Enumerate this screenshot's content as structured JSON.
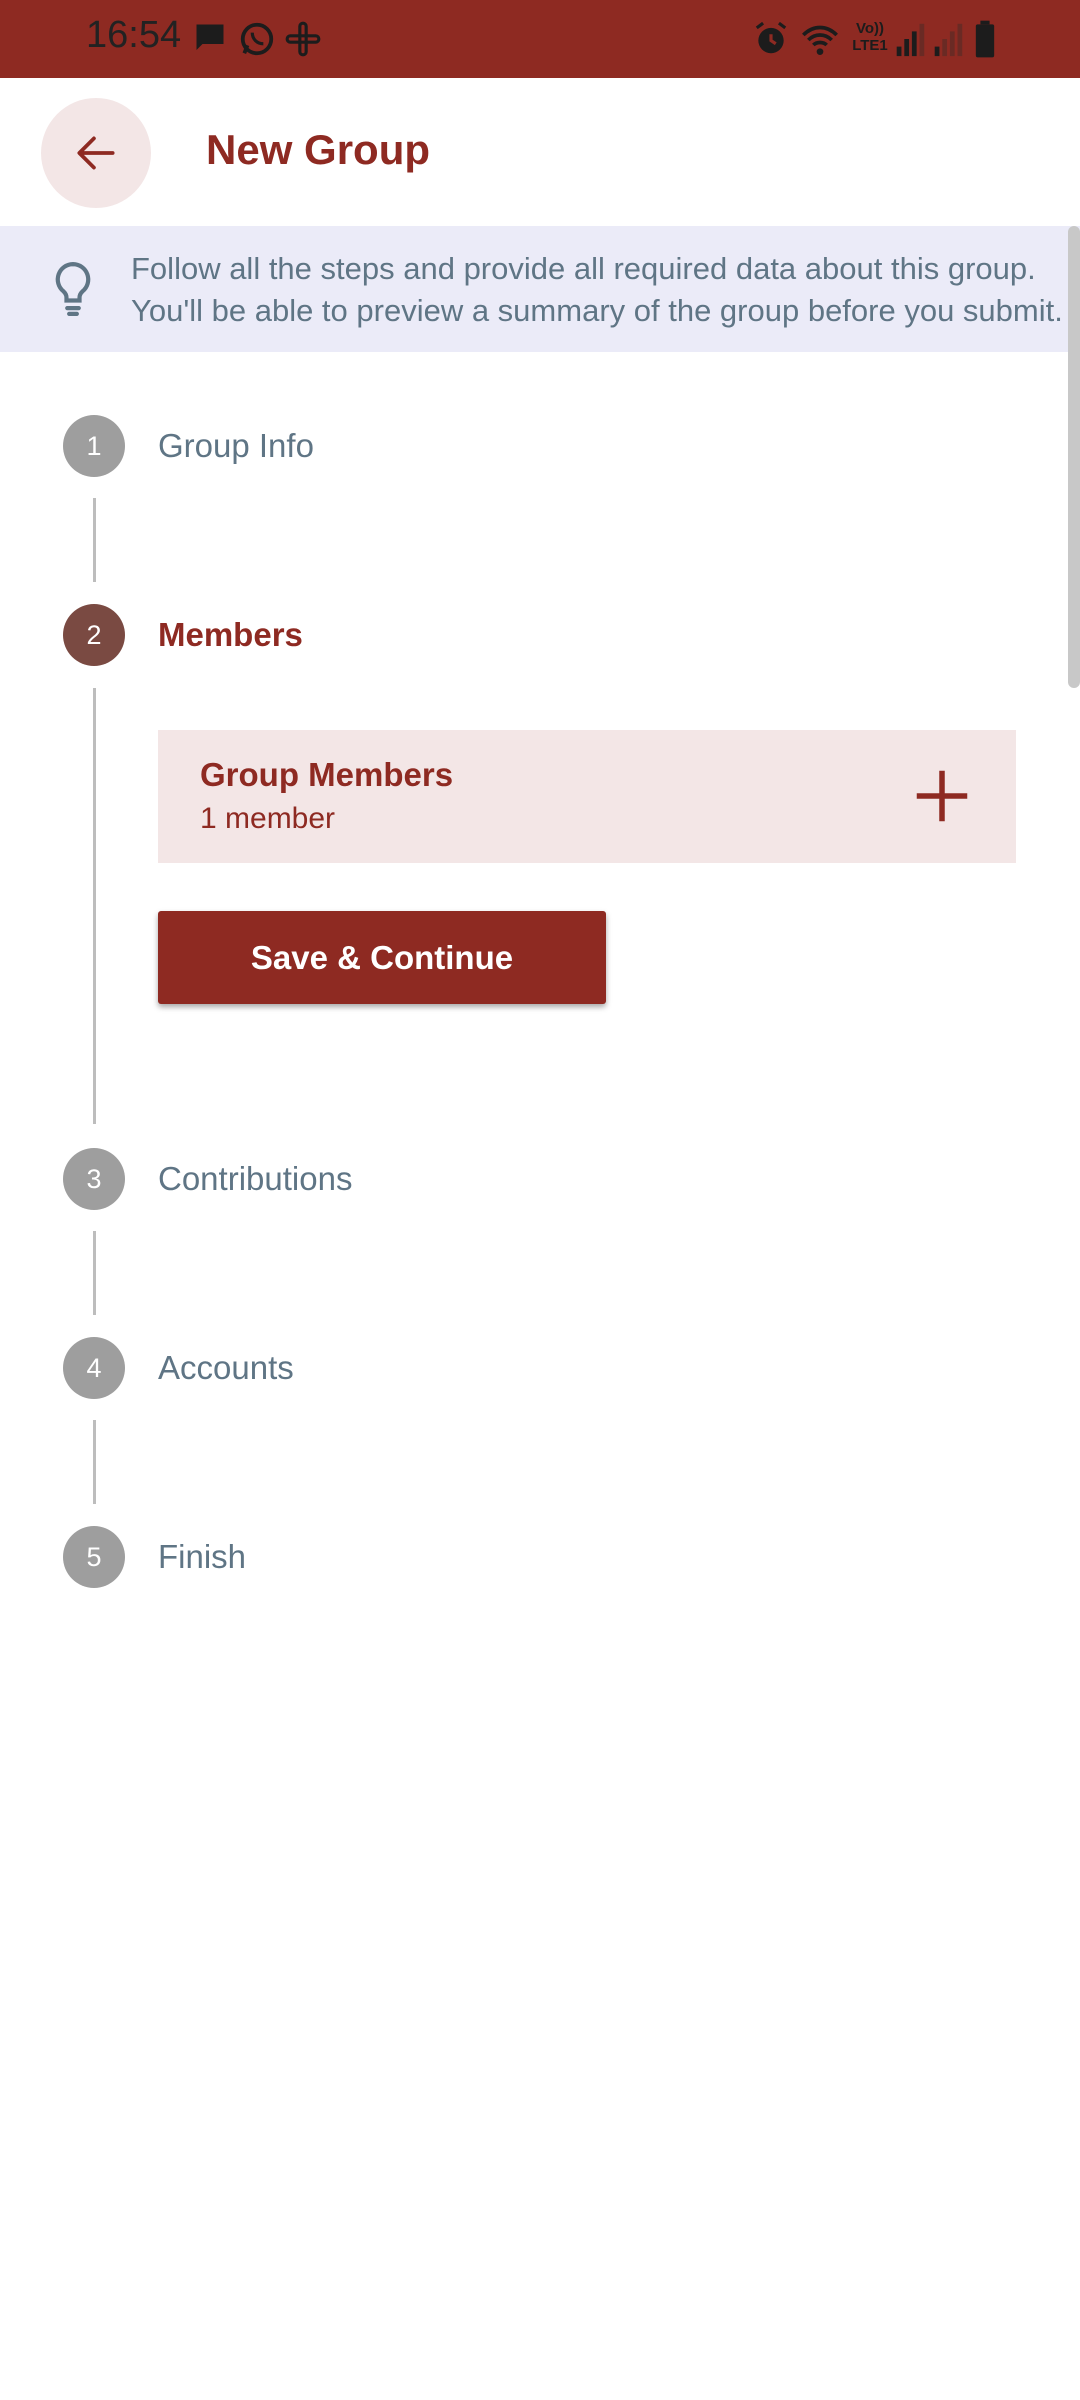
{
  "status_bar": {
    "time": "16:54",
    "left_icons": [
      "message-icon",
      "whatsapp-icon",
      "slack-icon"
    ],
    "right_icons": [
      "alarm-icon",
      "wifi-icon",
      "volte-icon",
      "signal-icon",
      "signal-weak-icon",
      "battery-icon"
    ],
    "volte_label_top": "Vo))",
    "volte_label_bottom": "LTE1"
  },
  "header": {
    "title": "New Group",
    "back_icon": "arrow-left-icon"
  },
  "tip": {
    "icon": "lightbulb-icon",
    "line1": "Follow all the steps and provide all required data about this group.",
    "line2": "You'll be able to preview a summary of the group before you submit."
  },
  "steps": [
    {
      "number": "1",
      "label": "Group Info",
      "active": false
    },
    {
      "number": "2",
      "label": "Members",
      "active": true
    },
    {
      "number": "3",
      "label": "Contributions",
      "active": false
    },
    {
      "number": "4",
      "label": "Accounts",
      "active": false
    },
    {
      "number": "5",
      "label": "Finish",
      "active": false
    }
  ],
  "members_card": {
    "title": "Group Members",
    "subtitle": "1 member",
    "add_icon": "plus-icon"
  },
  "save_button": {
    "label": "Save & Continue"
  },
  "colors": {
    "primary": "#8e2a22",
    "active_step": "#7a4a42",
    "inactive_step": "#9e9e9e",
    "tip_bg": "#ebebf8",
    "card_bg": "#f3e6e6",
    "muted_text": "#5f7585"
  }
}
